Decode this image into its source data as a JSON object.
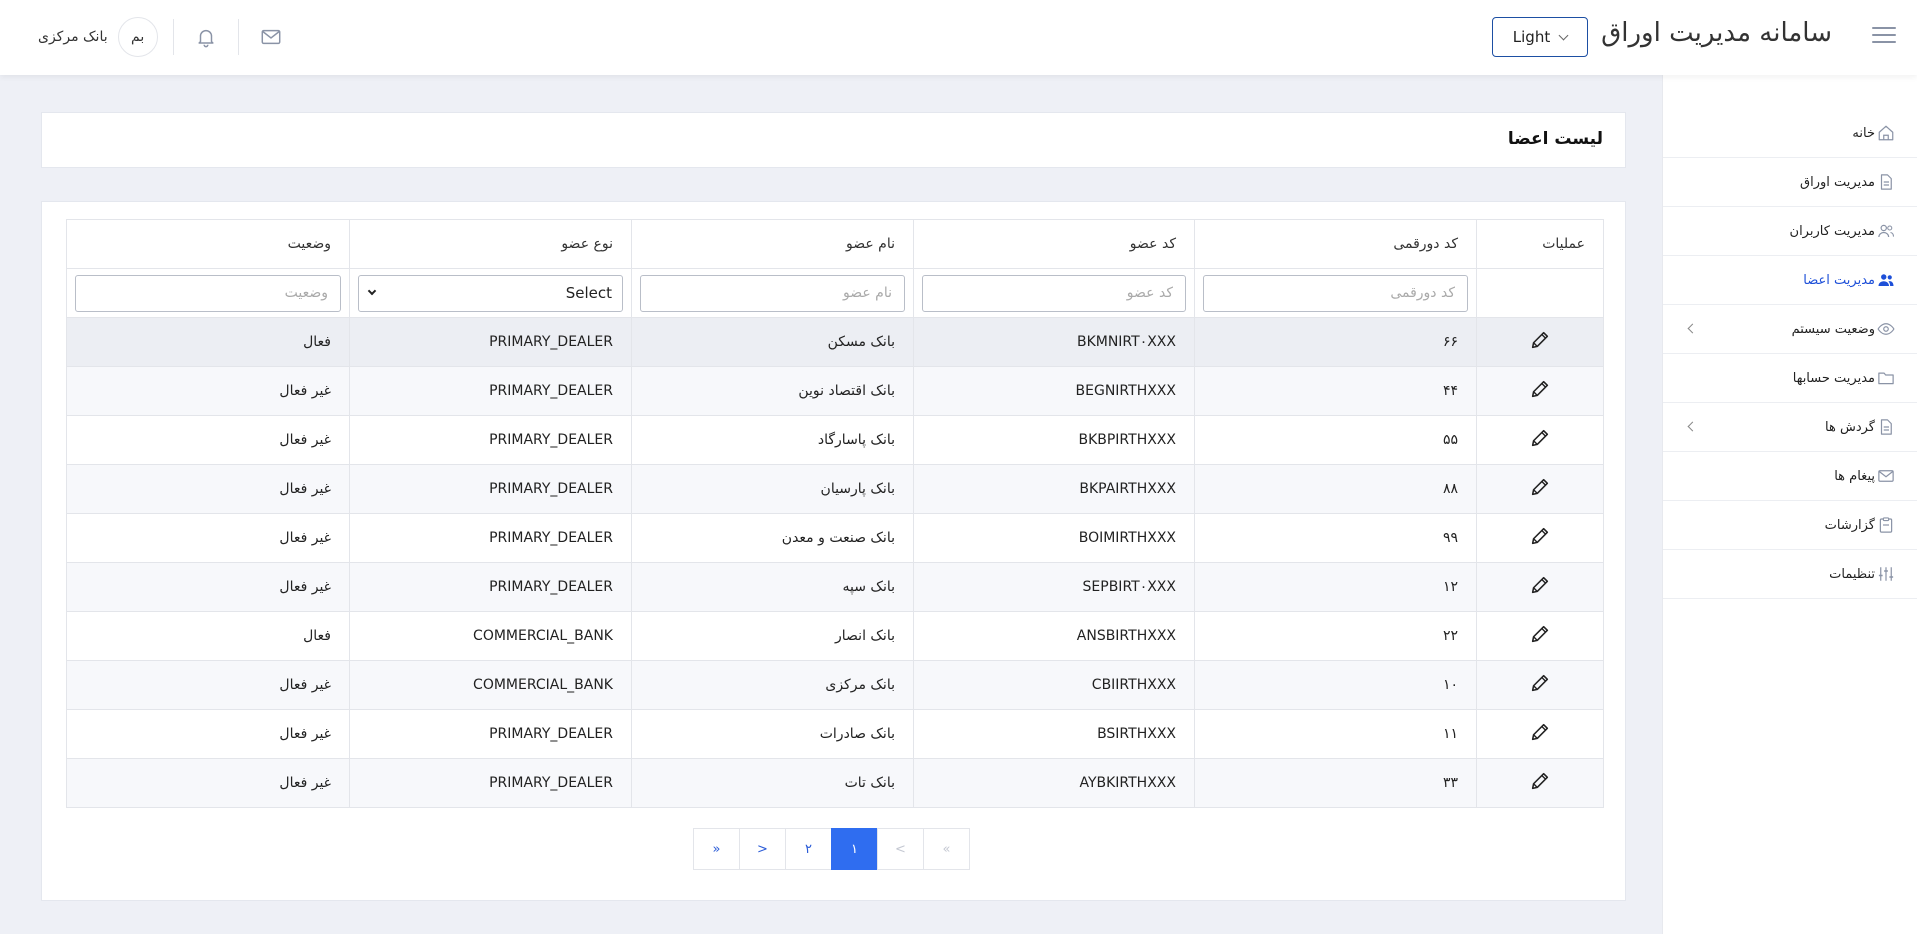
{
  "header": {
    "title": "سامانه مدیریت اوراق",
    "theme_label": "Light",
    "user_name": "بانک مرکزی",
    "avatar_text": "بم"
  },
  "sidebar": {
    "items": [
      {
        "label": "خانه",
        "icon": "home-icon",
        "active": false,
        "expandable": false
      },
      {
        "label": "مدیریت اوراق",
        "icon": "document-icon",
        "active": false,
        "expandable": false
      },
      {
        "label": "مدیریت کاربران",
        "icon": "users-icon",
        "active": false,
        "expandable": false
      },
      {
        "label": "مدیریت اعضا",
        "icon": "members-icon",
        "active": true,
        "expandable": false
      },
      {
        "label": "وضعیت سیستم",
        "icon": "eye-icon",
        "active": false,
        "expandable": true
      },
      {
        "label": "مدیریت حسابها",
        "icon": "folder-icon",
        "active": false,
        "expandable": false
      },
      {
        "label": "گردش ها",
        "icon": "document-icon",
        "active": false,
        "expandable": true
      },
      {
        "label": "پیغام ها",
        "icon": "mail-icon",
        "active": false,
        "expandable": false
      },
      {
        "label": "گزارشات",
        "icon": "clipboard-icon",
        "active": false,
        "expandable": false
      },
      {
        "label": "تنظیمات",
        "icon": "sliders-icon",
        "active": false,
        "expandable": false
      }
    ]
  },
  "page": {
    "title": "لیست اعضا"
  },
  "table": {
    "headers": {
      "operations": "عملیات",
      "code4": "کد دورقمی",
      "member_code": "کد عضو",
      "member_name": "نام عضو",
      "member_type": "نوع عضو",
      "status": "وضعیت"
    },
    "filters": {
      "code4_placeholder": "کد دورقمی",
      "member_code_placeholder": "کد عضو",
      "member_name_placeholder": "نام عضو",
      "type_selected": "Select",
      "status_placeholder": "وضعیت"
    },
    "rows": [
      {
        "code4": "۶۶",
        "member_code": "BKMNIRT۰XXX",
        "name": "بانک مسکن",
        "type": "PRIMARY_DEALER",
        "status": "فعال"
      },
      {
        "code4": "۴۴",
        "member_code": "BEGNIRTHXXX",
        "name": "بانک اقتصاد نوین",
        "type": "PRIMARY_DEALER",
        "status": "غیر فعال"
      },
      {
        "code4": "۵۵",
        "member_code": "BKBPIRTHXXX",
        "name": "بانک پاسارگاد",
        "type": "PRIMARY_DEALER",
        "status": "غیر فعال"
      },
      {
        "code4": "۸۸",
        "member_code": "BKPAIRTHXXX",
        "name": "بانک پارسیان",
        "type": "PRIMARY_DEALER",
        "status": "غیر فعال"
      },
      {
        "code4": "۹۹",
        "member_code": "BOIMIRTHXXX",
        "name": "بانک صنعت و معدن",
        "type": "PRIMARY_DEALER",
        "status": "غیر فعال"
      },
      {
        "code4": "۱۲",
        "member_code": "SEPBIRT۰XXX",
        "name": "بانک سپه",
        "type": "PRIMARY_DEALER",
        "status": "غیر فعال"
      },
      {
        "code4": "۲۲",
        "member_code": "ANSBIRTHXXX",
        "name": "بانک انصار",
        "type": "COMMERCIAL_BANK",
        "status": "فعال"
      },
      {
        "code4": "۱۰",
        "member_code": "CBIIRTHXXX",
        "name": "بانک مرکزی",
        "type": "COMMERCIAL_BANK",
        "status": "غیر فعال"
      },
      {
        "code4": "۱۱",
        "member_code": "BSIRTHXXX",
        "name": "بانک صادرات",
        "type": "PRIMARY_DEALER",
        "status": "غیر فعال"
      },
      {
        "code4": "۳۳",
        "member_code": "AYBKIRTHXXX",
        "name": "بانک تات",
        "type": "PRIMARY_DEALER",
        "status": "غیر فعال"
      }
    ]
  },
  "pagination": {
    "first": "«",
    "prev": "<",
    "pages": [
      "۱",
      "۲"
    ],
    "current": "۱",
    "next": ">",
    "last": "»"
  },
  "colors": {
    "accent": "#2f6df0",
    "active_nav": "#1d4fd8"
  }
}
